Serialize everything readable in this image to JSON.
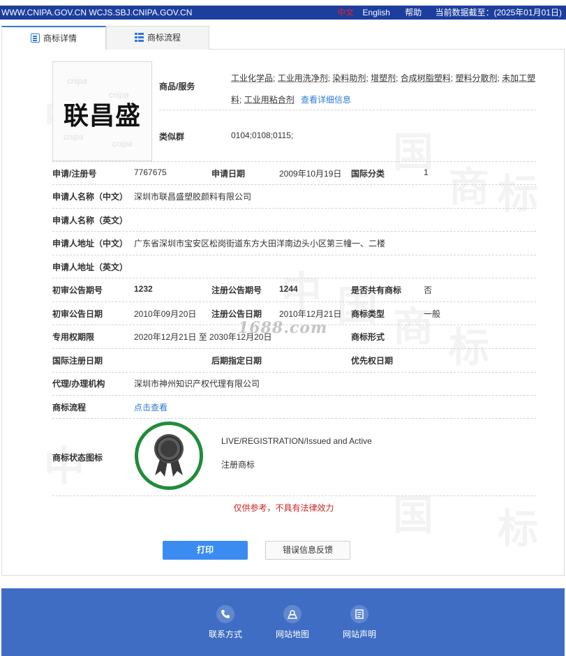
{
  "topbar": {
    "site": "WWW.CNIPA.GOV.CN WCJS.SBJ.CNIPA.GOV.CN",
    "lang_cn": "中文",
    "lang_en": "English",
    "help": "帮助",
    "data_date": "当前数据截至：(2025年01月01日)"
  },
  "tabs": [
    {
      "label": "商标详情",
      "active": true,
      "icon": "list-icon"
    },
    {
      "label": "商标流程",
      "active": false,
      "icon": "grid-icon"
    }
  ],
  "trademark": {
    "image_text": "联昌盛",
    "goods_label": "商品/服务",
    "goods": [
      "工业化学品",
      "工业用洗净剂",
      "染料助剂",
      "增塑剂",
      "合成树脂塑料",
      "塑料分散剂",
      "未加工塑料",
      "工业用粘合剂"
    ],
    "goods_more": "查看详细信息",
    "similar_group_label": "类似群",
    "similar_group": "0104;0108;0115;",
    "reg_no_label": "申请/注册号",
    "reg_no": "7767675",
    "apply_date_label": "申请日期",
    "apply_date": "2009年10月19日",
    "intl_class_label": "国际分类",
    "intl_class": "1",
    "applicant_cn_label": "申请人名称（中文）",
    "applicant_cn": "深圳市联昌盛塑胶颜料有限公司",
    "applicant_en_label": "申请人名称（英文）",
    "applicant_en": "",
    "address_cn_label": "申请人地址（中文）",
    "address_cn": "广东省深圳市宝安区松岗街道东方大田洋南边头小区第三幢一、二楼",
    "address_en_label": "申请人地址（英文）",
    "address_en": "",
    "prelim_no_label": "初审公告期号",
    "prelim_no": "1232",
    "reg_pub_no_label": "注册公告期号",
    "reg_pub_no": "1244",
    "shared_label": "是否共有商标",
    "shared": "否",
    "prelim_date_label": "初审公告日期",
    "prelim_date": "2010年09月20日",
    "reg_pub_date_label": "注册公告日期",
    "reg_pub_date": "2010年12月21日",
    "mark_type_label": "商标类型",
    "mark_type": "一般",
    "term_label": "专用权期限",
    "term": "2020年12月21日 至 2030年12月20日",
    "mark_form_label": "商标形式",
    "mark_form": "",
    "intl_reg_date_label": "国际注册日期",
    "intl_reg_date": "",
    "later_date_label": "后期指定日期",
    "later_date": "",
    "priority_date_label": "优先权日期",
    "priority_date": "",
    "agent_label": "代理/办理机构",
    "agent": "深圳市神州知识产权代理有限公司",
    "process_label": "商标流程",
    "process_link": "点击查看",
    "status_icon_label": "商标状态图标",
    "status_en": "LIVE/REGISTRATION/Issued and Active",
    "status_cn": "注册商标"
  },
  "notice": "仅供参考，不具有法律效力",
  "buttons": {
    "print": "打印",
    "feedback": "错误信息反馈"
  },
  "footer": [
    {
      "label": "联系方式",
      "icon": "phone-icon"
    },
    {
      "label": "网站地图",
      "icon": "map-icon"
    },
    {
      "label": "网站声明",
      "icon": "document-icon"
    }
  ],
  "overlay_watermark": "1688.com",
  "colors": {
    "topbar": "#1c3e9e",
    "accent": "#2e7ad6",
    "footer": "#3f6dc4",
    "badge_ring": "#1f8c3a",
    "notice": "#d42020"
  }
}
